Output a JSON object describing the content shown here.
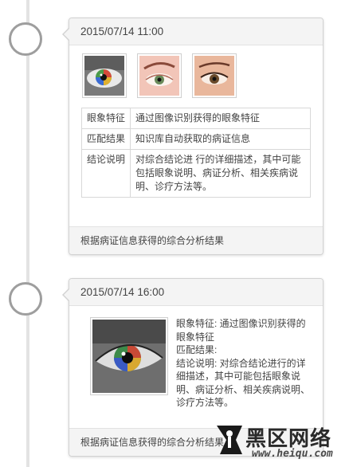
{
  "timeline": {
    "entries": [
      {
        "timestamp": "2015/07/14 11:00",
        "images": [
          {
            "name": "eye-photo-colored-iris"
          },
          {
            "name": "eye-photo-brow"
          },
          {
            "name": "eye-photo-lashes"
          }
        ],
        "table": [
          {
            "key": "眼象特征",
            "value": "通过图像识别获得的眼象特征"
          },
          {
            "key": "匹配结果",
            "value": "知识库自动获取的病证信息"
          },
          {
            "key": "结论说明",
            "value": "对综合结论进 行的详细描述，其中可能包括眼象说明、病证分析、相关疾病说明、诊疗方法等。"
          }
        ],
        "footer": "根据病证信息获得的综合分析结果"
      },
      {
        "timestamp": "2015/07/14 16:00",
        "description": {
          "line1": "眼象特征: 通过图像识别获得的眼象特征",
          "line2": "匹配结果:",
          "line3": "结论说明: 对综合结论进行的详细描述，其中可能包括眼象说明、病证分析、相关疾病说明、诊疗方法等。"
        },
        "footer": "根据病证信息获得的综合分析结果"
      }
    ]
  },
  "watermark": {
    "title": "黑区网络",
    "url": "www.heiqu.com"
  }
}
